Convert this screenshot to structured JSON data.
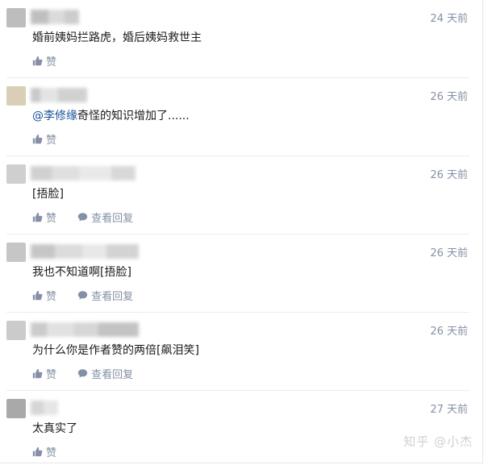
{
  "comments": [
    {
      "time": "24 天前",
      "content": "婚前姨妈拦路虎，婚后姨妈救世主",
      "like_label": "赞"
    },
    {
      "time": "26 天前",
      "mention": "@李修缘",
      "content": "奇怪的知识增加了......",
      "like_label": "赞"
    },
    {
      "time": "26 天前",
      "content": "[捂脸]",
      "like_label": "赞",
      "reply_label": "查看回复"
    },
    {
      "time": "26 天前",
      "content": "我也不知道啊[捂脸]",
      "like_label": "赞",
      "reply_label": "查看回复"
    },
    {
      "time": "26 天前",
      "content": "为什么你是作者赞的两倍[飙泪笑]",
      "like_label": "赞",
      "reply_label": "查看回复"
    },
    {
      "time": "27 天前",
      "content": "太真实了",
      "like_label": "赞"
    }
  ],
  "watermark": "知乎 @小杰",
  "colors": {
    "meta": "#8590a6",
    "link": "#175199",
    "text": "#1a1a1a"
  },
  "icons": {
    "like": "thumbs-up-icon",
    "reply": "speech-bubble-icon"
  }
}
